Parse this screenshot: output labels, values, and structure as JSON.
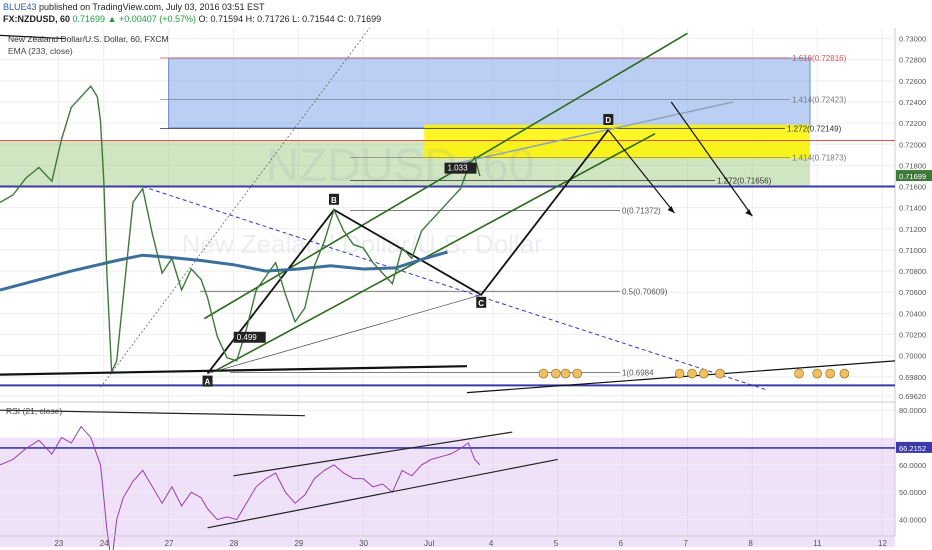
{
  "header": {
    "author": "BLUE43",
    "published_text": "published on TradingView.com, July 03, 2016 03:51 EST",
    "symbol": "FX:NZDUSD, 60",
    "change": "0.71699 ▲ +0.00407 (+0.57%)",
    "ohlc": "O: 0.71594 H: 0.71726 L: 0.71544 C: 0.71699"
  },
  "main_pane": {
    "title": "New Zealand Dollar/U.S. Dollar, 60, FXCM",
    "ema_label": "EMA (233, close)",
    "watermark_symbol": "NZDUSD, 60",
    "watermark_name": "New Zealand Dollar/U.S. Dollar",
    "current_price": "0.71699"
  },
  "rsi_pane": {
    "label": "RSI (21, close)",
    "current_value": "66.2152"
  },
  "chart_data": [
    {
      "type": "line",
      "title": "New Zealand Dollar/U.S. Dollar, 60, FXCM",
      "x_ticks": [
        "23",
        "24",
        "27",
        "28",
        "29",
        "30",
        "Jul",
        "4",
        "5",
        "6",
        "7",
        "8",
        "11",
        "12"
      ],
      "x_tick_pos": [
        0.3,
        1,
        2,
        3,
        4,
        5,
        6,
        7,
        8,
        9,
        10,
        11,
        12,
        13
      ],
      "xlim": [
        -0.6,
        13.2
      ],
      "ylim": [
        0.6958,
        0.731
      ],
      "y_ticks": [
        "0.73000",
        "0.72800",
        "0.72600",
        "0.72400",
        "0.72200",
        "0.72000",
        "0.71800",
        "0.71600",
        "0.71400",
        "0.71200",
        "0.71000",
        "0.70800",
        "0.70600",
        "0.70400",
        "0.70200",
        "0.70000",
        "0.69800",
        "0.69620"
      ],
      "y_tick_values": [
        0.73,
        0.728,
        0.726,
        0.724,
        0.722,
        0.72,
        0.718,
        0.716,
        0.714,
        0.712,
        0.71,
        0.708,
        0.706,
        0.704,
        0.702,
        0.7,
        0.698,
        0.6962
      ],
      "price": {
        "x": [
          -0.6,
          -0.4,
          -0.2,
          0,
          0.2,
          0.35,
          0.5,
          0.65,
          0.8,
          0.9,
          0.95,
          1.0,
          1.05,
          1.12,
          1.2,
          1.3,
          1.45,
          1.6,
          1.75,
          1.9,
          2.05,
          2.2,
          2.35,
          2.5,
          2.6,
          2.75,
          2.9,
          3.05,
          3.2,
          3.35,
          3.5,
          3.65,
          3.8,
          3.95,
          4.1,
          4.25,
          4.4,
          4.55,
          4.7,
          4.85,
          5.0,
          5.15,
          5.3,
          5.45,
          5.6,
          5.75,
          5.9,
          6.05,
          6.2,
          6.35,
          6.5,
          6.62,
          6.72,
          6.8
        ],
        "y": [
          0.7145,
          0.7152,
          0.7168,
          0.7178,
          0.7165,
          0.7205,
          0.7235,
          0.7245,
          0.7255,
          0.7245,
          0.7222,
          0.7165,
          0.7075,
          0.6985,
          0.6995,
          0.7055,
          0.7145,
          0.7158,
          0.7115,
          0.7078,
          0.7092,
          0.7062,
          0.7082,
          0.7072,
          0.7055,
          0.7018,
          0.6998,
          0.6995,
          0.7025,
          0.7062,
          0.7075,
          0.7088,
          0.7058,
          0.7032,
          0.7045,
          0.7085,
          0.7108,
          0.7138,
          0.7118,
          0.7105,
          0.7102,
          0.7088,
          0.7078,
          0.7068,
          0.7102,
          0.7092,
          0.7118,
          0.7128,
          0.7138,
          0.7148,
          0.7158,
          0.7178,
          0.7188,
          0.717
        ]
      },
      "ema": {
        "name": "EMA (233, close)",
        "x": [
          -0.6,
          0.5,
          1.2,
          1.6,
          2.0,
          2.5,
          3.0,
          3.5,
          4.0,
          4.5,
          5.0,
          5.5,
          5.9,
          6.3
        ],
        "y": [
          0.7062,
          0.708,
          0.709,
          0.7095,
          0.7093,
          0.709,
          0.7086,
          0.708,
          0.7082,
          0.7085,
          0.7082,
          0.7083,
          0.7091,
          0.7098
        ]
      },
      "current_price": 0.71699,
      "horizontal_levels": [
        0.716,
        0.69718
      ],
      "zones": [
        {
          "name": "green-zone",
          "x0": -0.6,
          "x1": 13.2,
          "y0": 0.716,
          "y1": 0.72035
        },
        {
          "name": "blue-zone",
          "x0": 2.0,
          "x1": 12.6,
          "y0": 0.72155,
          "y1": 0.72815
        },
        {
          "name": "yellow-zone",
          "x0": 5.94,
          "x1": 12.6,
          "y0": 0.71865,
          "y1": 0.72185
        }
      ],
      "harmonic_points": [
        {
          "label": "A",
          "x": 2.6,
          "y": 0.6983
        },
        {
          "label": "B",
          "x": 4.55,
          "y": 0.7138
        },
        {
          "label": "C",
          "x": 6.82,
          "y": 0.70575
        },
        {
          "label": "D",
          "x": 8.78,
          "y": 0.72135
        }
      ],
      "fib_levels": [
        {
          "label": "1.618(0.72816)",
          "y": 0.72816,
          "color": "#d9534f"
        },
        {
          "label": "1.414(0.72423)",
          "y": 0.72423,
          "color": "#777777"
        },
        {
          "label": "1.272(0.72149)",
          "y": 0.72149,
          "color": "#333333"
        },
        {
          "label": "1.414(0.71873)",
          "y": 0.71873,
          "color": "#777777"
        },
        {
          "label": "1.272(0.71656)",
          "y": 0.71656,
          "color": "#333333"
        },
        {
          "label": "0(0.71372)",
          "y": 0.71372,
          "color": "#555555"
        },
        {
          "label": "0.5(0.70609)",
          "y": 0.70609,
          "color": "#555555"
        },
        {
          "label": "1(0.6984",
          "y": 0.6984,
          "color": "#555555"
        }
      ],
      "annotations": [
        "0.499",
        "1.033"
      ]
    },
    {
      "type": "line",
      "title": "RSI (21, close)",
      "ylim": [
        34,
        83
      ],
      "y_ticks": [
        "80.0000",
        "60.0000",
        "50.0000",
        "40.0000"
      ],
      "y_tick_values": [
        80,
        60,
        50,
        40
      ],
      "current_value": 66.2152,
      "bands": [
        30,
        70
      ],
      "rsi": {
        "x": [
          -0.6,
          -0.4,
          -0.2,
          0,
          0.2,
          0.35,
          0.5,
          0.65,
          0.8,
          0.95,
          1.0,
          1.05,
          1.12,
          1.2,
          1.3,
          1.45,
          1.6,
          1.75,
          1.9,
          2.05,
          2.2,
          2.35,
          2.5,
          2.6,
          2.75,
          2.9,
          3.05,
          3.2,
          3.35,
          3.5,
          3.65,
          3.8,
          3.95,
          4.1,
          4.25,
          4.4,
          4.55,
          4.7,
          4.85,
          5.0,
          5.15,
          5.3,
          5.45,
          5.6,
          5.75,
          5.9,
          6.05,
          6.2,
          6.35,
          6.5,
          6.62,
          6.72,
          6.8
        ],
        "y": [
          60,
          62,
          66,
          69,
          64,
          70,
          68,
          74,
          70,
          60,
          48,
          36,
          24,
          40,
          48,
          54,
          58,
          52,
          46,
          52,
          45,
          50,
          48,
          44,
          40,
          41,
          40,
          46,
          52,
          55,
          57,
          50,
          46,
          49,
          55,
          58,
          60,
          57,
          55,
          55,
          52,
          53,
          50,
          58,
          56,
          60,
          62,
          63,
          64,
          66,
          68,
          62,
          60
        ]
      }
    }
  ]
}
